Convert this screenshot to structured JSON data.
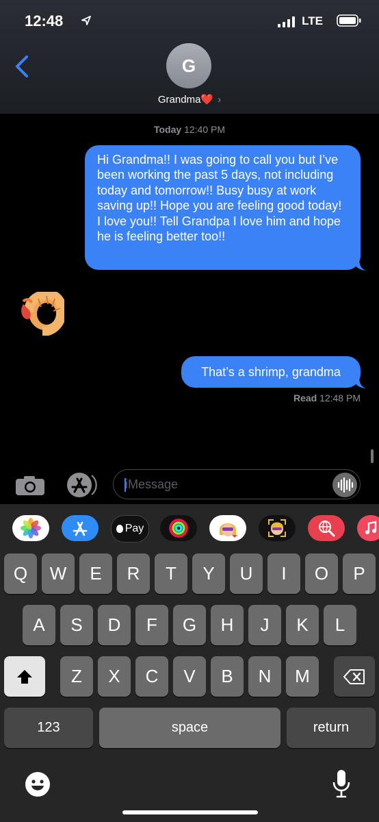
{
  "status_bar": {
    "time": "12:48",
    "network": "LTE"
  },
  "header": {
    "avatar_letter": "G",
    "contact_name": "Grandma❤️",
    "chevron": "›"
  },
  "conversation": {
    "timestamp_day": "Today",
    "timestamp_time": "12:40 PM",
    "messages": [
      {
        "from": "me",
        "text": "Hi Grandma!! I was going to call you but I’ve been working the past 5 days, not including today and tomorrow!! Busy busy at work saving up!! Hope you are feeling good today! I love you!! Tell Grandpa I love him and hope he is feeling better too!!"
      },
      {
        "from": "them",
        "type": "sticker",
        "icon": "shrimp-emoji"
      },
      {
        "from": "me",
        "text": "That’s a shrimp, grandma"
      }
    ],
    "read_label": "Read",
    "read_time": "12:48 PM"
  },
  "compose": {
    "placeholder": "iMessage"
  },
  "app_drawer": [
    "photos",
    "app-store",
    "apple-pay",
    "activity",
    "memoji",
    "memoji-stickers",
    "web-images",
    "music"
  ],
  "apple_pay_label": "Pay",
  "keyboard": {
    "row1": [
      "Q",
      "W",
      "E",
      "R",
      "T",
      "Y",
      "U",
      "I",
      "O",
      "P"
    ],
    "row2": [
      "A",
      "S",
      "D",
      "F",
      "G",
      "H",
      "J",
      "K",
      "L"
    ],
    "row3": [
      "Z",
      "X",
      "C",
      "V",
      "B",
      "N",
      "M"
    ],
    "numbers_label": "123",
    "space_label": "space",
    "return_label": "return"
  },
  "colors": {
    "bubble": "#3a82f6",
    "background": "#000000",
    "key": "#6b6b6b"
  }
}
